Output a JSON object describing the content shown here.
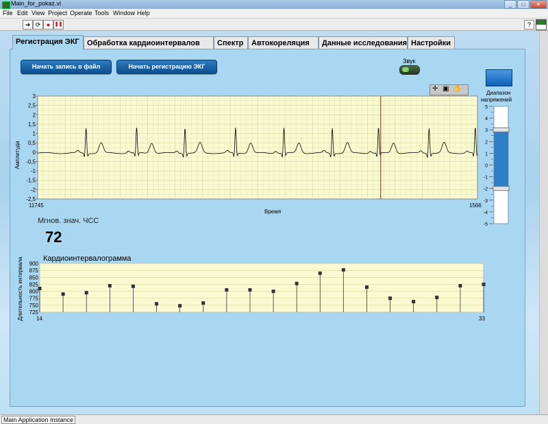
{
  "window": {
    "title": "Main_for_pokaz.vi",
    "controls": [
      "_",
      "□",
      "✕"
    ]
  },
  "menu": {
    "items": [
      "File",
      "Edit",
      "View",
      "Project",
      "Operate",
      "Tools",
      "Window",
      "Help"
    ]
  },
  "toolbar": {
    "run": "➔",
    "run_continuous": "⟳",
    "abort": "●",
    "pause": "❚❚",
    "help": "?"
  },
  "tabs": [
    {
      "label": "Регистрация ЭКГ",
      "active": true
    },
    {
      "label": "Обработка кардиоинтервалов",
      "active": false
    },
    {
      "label": "Спектр",
      "active": false
    },
    {
      "label": "Автокореляция",
      "active": false
    },
    {
      "label": "Данные исследования",
      "active": false
    },
    {
      "label": "Настройки",
      "active": false
    }
  ],
  "buttons": {
    "start_file": "Начать запись в файл",
    "start_ecg": "Начать регистрацию ЭКГ"
  },
  "sound": {
    "label": "Звук"
  },
  "voltage": {
    "label_line1": "Диапазон",
    "label_line2": "напряжений",
    "ticks": [
      "5",
      "4",
      "3",
      "2",
      "1",
      "0",
      "-1",
      "-2",
      "-3",
      "-4",
      "-5"
    ],
    "upper_value": 3.0,
    "lower_value": -2.0
  },
  "ecg": {
    "ylabel": "Амплитуда",
    "xlabel": "Время",
    "x_start": "11745",
    "x_end": "1566",
    "y_ticks": [
      "3",
      "2,5",
      "2",
      "1,5",
      "1",
      "0,5",
      "0",
      "-0,5",
      "-1",
      "-1,5",
      "-2",
      "-2,5"
    ],
    "ylim": [
      -2.5,
      3
    ],
    "cursor_frac": 0.78,
    "beats_frac": [
      0.11,
      0.225,
      0.335,
      0.45,
      0.56,
      0.67,
      0.775,
      0.89,
      0.995
    ],
    "colors": {
      "bg": "#fafad2",
      "grid": "#d8d8a0",
      "trace": "#000000",
      "cursor": "#e00000"
    }
  },
  "heart_rate": {
    "label": "Мгнов. знач. ЧСС",
    "value": "72"
  },
  "chart_data": {
    "type": "scatter",
    "title": "Кардиоинтервалограмма",
    "ylabel": "Длительность интервала",
    "xlabel": "",
    "x_start": "14",
    "x_end": "33",
    "ylim": [
      725,
      900
    ],
    "y_ticks": [
      "900",
      "875",
      "850",
      "825",
      "800",
      "775",
      "750",
      "725"
    ],
    "x": [
      14,
      15,
      16,
      17,
      18,
      19,
      20,
      21,
      22,
      23,
      24,
      25,
      26,
      27,
      28,
      29,
      30,
      31,
      32,
      33
    ],
    "values": [
      810,
      790,
      795,
      820,
      818,
      755,
      748,
      758,
      805,
      805,
      800,
      828,
      865,
      877,
      815,
      775,
      763,
      778,
      820,
      825
    ]
  },
  "status": {
    "instance": "Main Application Instance"
  }
}
